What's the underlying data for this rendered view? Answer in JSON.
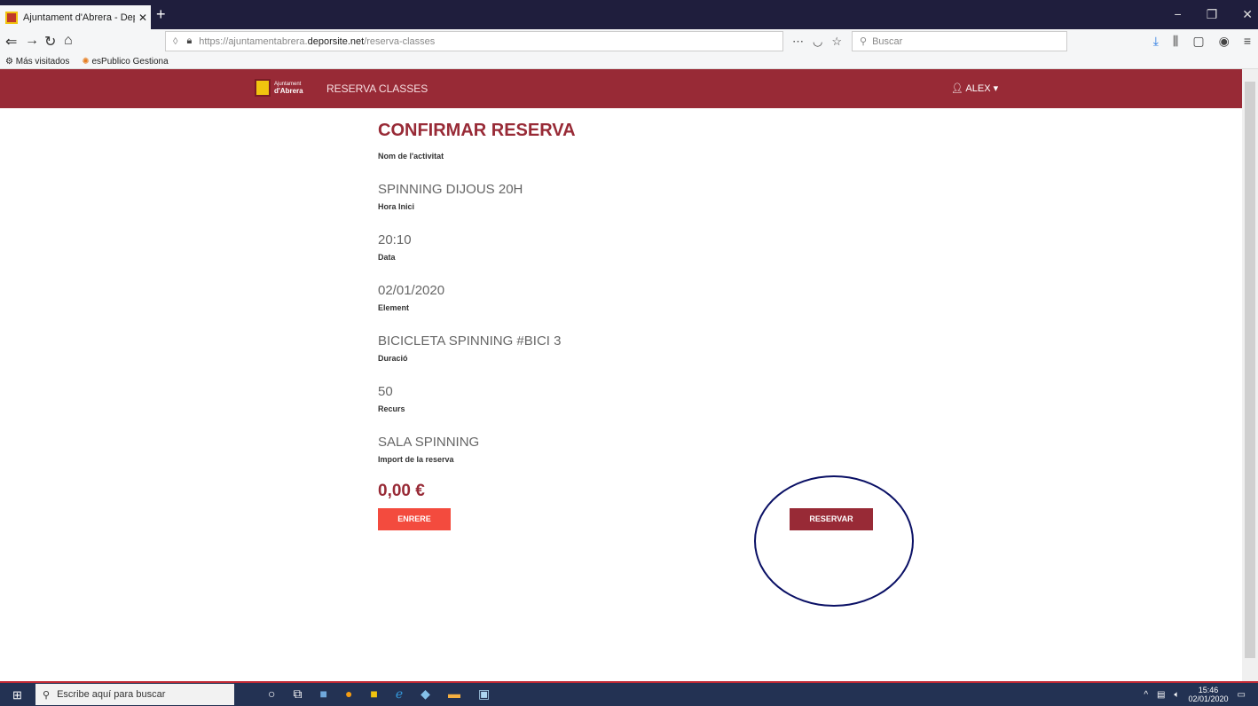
{
  "browser": {
    "tab_title": "Ajuntament d'Abrera - DeporSi",
    "tab_close": "✕",
    "new_tab": "+",
    "window_controls": [
      "−",
      "❐",
      "✕"
    ],
    "url_prefix": "https://ajuntamentabrera.",
    "url_domain": "deporsite.net",
    "url_path": "/reserva-classes",
    "search_placeholder": "Buscar",
    "bookmarks": [
      "Más visitados",
      "esPublico Gestiona"
    ]
  },
  "site": {
    "logo_small": "Ajuntament",
    "logo_big": "d'Abrera",
    "nav_link": "RESERVA CLASSES",
    "user": "ALEX"
  },
  "page": {
    "title": "CONFIRMAR RESERVA",
    "fields": [
      {
        "label": "Nom de l'activitat",
        "value": "SPINNING DIJOUS 20H"
      },
      {
        "label": "Hora Inici",
        "value": "20:10"
      },
      {
        "label": "Data",
        "value": "02/01/2020"
      },
      {
        "label": "Element",
        "value": "BICICLETA SPINNING #BICI 3"
      },
      {
        "label": "Duració",
        "value": "50"
      },
      {
        "label": "Recurs",
        "value": "SALA SPINNING"
      }
    ],
    "price_label": "Import de la reserva",
    "price": "0,00 €",
    "back_button": "ENRERE",
    "reserve_button": "RESERVAR"
  },
  "taskbar": {
    "search_placeholder": "Escribe aquí para buscar",
    "time": "15:46",
    "date": "02/01/2020"
  },
  "colors": {
    "brand": "#982a36",
    "back_button": "#f34b3e",
    "annotation_circle": "#0a1065"
  }
}
